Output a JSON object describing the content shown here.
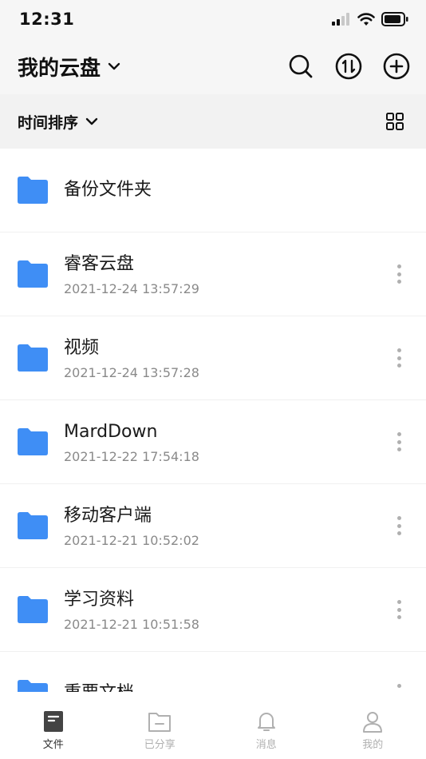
{
  "status_bar": {
    "time": "12:31"
  },
  "header": {
    "title": "我的云盘"
  },
  "sort_bar": {
    "label": "时间排序"
  },
  "files": [
    {
      "name": "备份文件夹",
      "time": ""
    },
    {
      "name": "睿客云盘",
      "time": "2021-12-24 13:57:29"
    },
    {
      "name": "视频",
      "time": "2021-12-24 13:57:28"
    },
    {
      "name": "MardDown",
      "time": "2021-12-22 17:54:18"
    },
    {
      "name": "移动客户端",
      "time": "2021-12-21 10:52:02"
    },
    {
      "name": "学习资料",
      "time": "2021-12-21 10:51:58"
    },
    {
      "name": "重要文档",
      "time": ""
    }
  ],
  "tabs": [
    {
      "label": "文件",
      "icon": "file-icon",
      "active": true
    },
    {
      "label": "已分享",
      "icon": "shared-folder-icon",
      "active": false
    },
    {
      "label": "消息",
      "icon": "bell-icon",
      "active": false
    },
    {
      "label": "我的",
      "icon": "user-icon",
      "active": false
    }
  ],
  "colors": {
    "folder": "#3f8ef5",
    "header_bg": "#f6f6f6",
    "sort_bg": "#f2f2f2",
    "muted_text": "#8a8a8a"
  }
}
